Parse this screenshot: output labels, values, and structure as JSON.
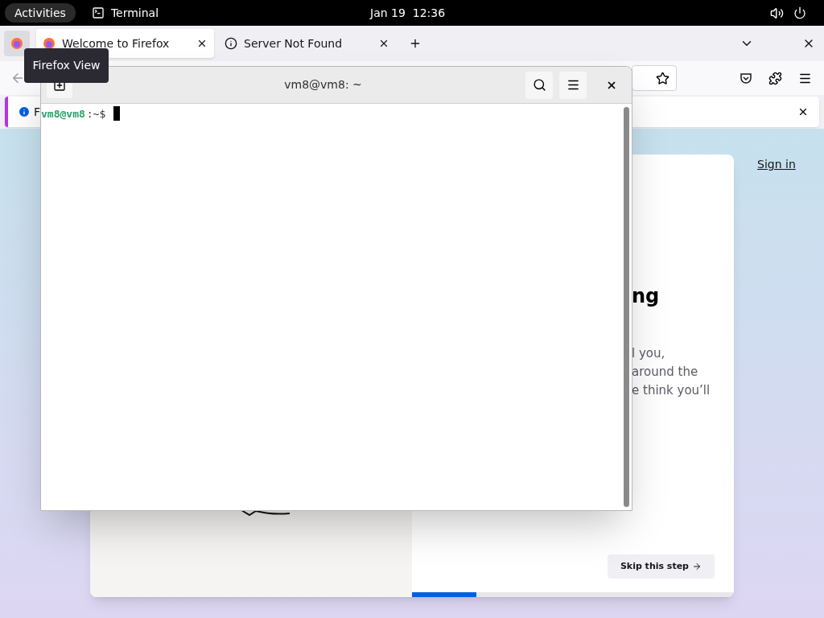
{
  "top_bar": {
    "activities": "Activities",
    "app": "Terminal",
    "clock": "Jan 19  12:36"
  },
  "browser": {
    "tabs": [
      {
        "title": "Welcome to Firefox",
        "selected": true,
        "kind": "firefox"
      },
      {
        "title": "Server Not Found",
        "selected": false,
        "kind": "info"
      }
    ],
    "tooltip": "Firefox View",
    "notification": {
      "text": "F"
    },
    "page": {
      "sign_in": "Sign in",
      "heading": "ng",
      "paragraph_lines": [
        "l you,",
        "around the",
        "e think you’ll"
      ],
      "skip_button": "Skip this step",
      "progress": {
        "level": 0.2
      }
    }
  },
  "terminal": {
    "title": "vm8@vm8: ~",
    "prompt_user": "vm8@vm8",
    "prompt_path": ":~$"
  }
}
